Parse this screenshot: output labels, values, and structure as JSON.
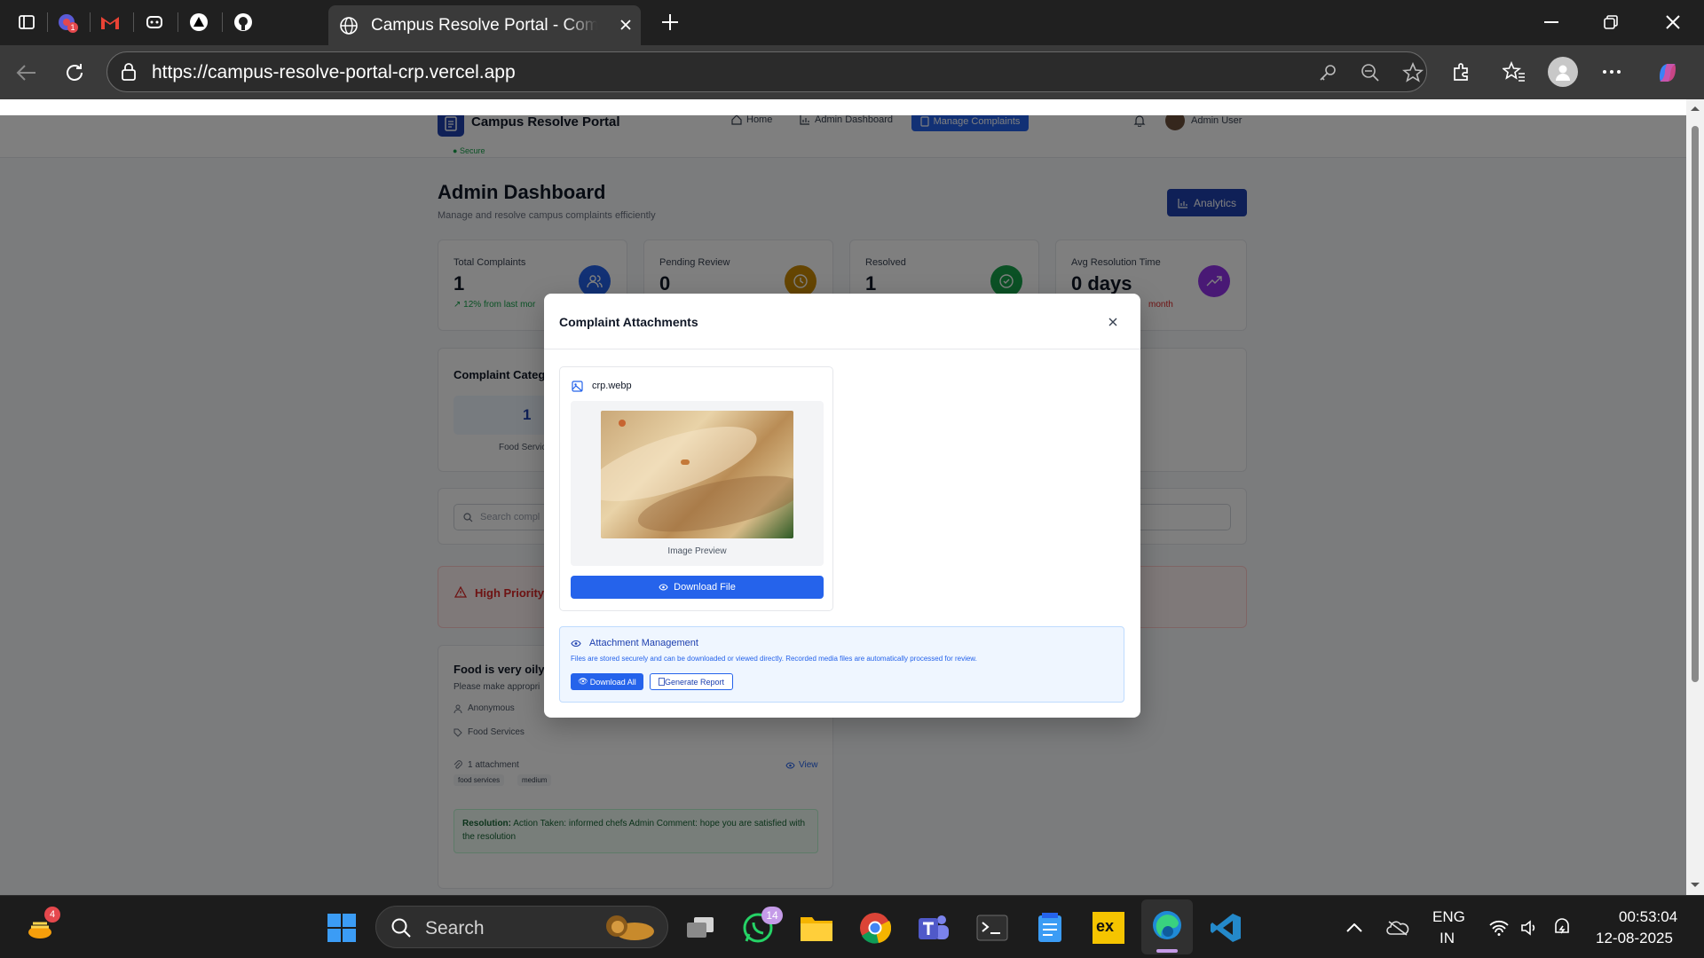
{
  "browser": {
    "tab_title": "Campus Resolve Portal - Complet",
    "url": "https://campus-resolve-portal-crp.vercel.app",
    "tab_badge_count": "1"
  },
  "app": {
    "brand": "Campus Resolve Portal",
    "secure_label": "Secure",
    "nav": {
      "home": "Home",
      "admin_dashboard": "Admin Dashboard",
      "manage_complaints": "Manage Complaints"
    },
    "user_name": "Admin User"
  },
  "dashboard": {
    "title": "Admin Dashboard",
    "subtitle": "Manage and resolve campus complaints efficiently",
    "analytics_button": "Analytics",
    "stats": [
      {
        "label": "Total Complaints",
        "value": "1",
        "trend": "12% from last mor"
      },
      {
        "label": "Pending Review",
        "value": "0"
      },
      {
        "label": "Resolved",
        "value": "1"
      },
      {
        "label": "Avg Resolution Time",
        "value": "0 days",
        "trend": "month"
      }
    ],
    "category_title": "Complaint Categ",
    "category_count": "1",
    "category_name": "Food Servic",
    "search_placeholder": "Search compl",
    "high_priority_label": "High Priority",
    "complaint": {
      "title": "Food is very oily",
      "body": "Please make appropri",
      "author": "Anonymous",
      "category": "Food Services",
      "attachments": "1 attachment",
      "view": "View",
      "tags": [
        "food services",
        "medium"
      ],
      "resolution_label": "Resolution:",
      "resolution_text": "Action Taken: informed chefs Admin Comment: hope you are satisfied with the resolution"
    }
  },
  "modal": {
    "title": "Complaint Attachments",
    "file_name": "crp.webp",
    "preview_caption": "Image Preview",
    "download_file": "Download File",
    "management_title": "Attachment Management",
    "management_desc": "Files are stored securely and can be downloaded or viewed directly. Recorded media files are automatically processed for review.",
    "download_all": "Download All",
    "generate_report": "Generate Report"
  },
  "taskbar": {
    "widget_badge": "4",
    "search_placeholder": "Search",
    "whatsapp_badge": "14",
    "lang_line1": "ENG",
    "lang_line2": "IN",
    "time": "00:53:04",
    "date": "12-08-2025"
  },
  "colors": {
    "accent": "#2563eb",
    "brand_dark": "#1e40af",
    "danger": "#dc2626",
    "success": "#16a34a",
    "warning": "#ca8a04",
    "purple": "#9333ea"
  }
}
